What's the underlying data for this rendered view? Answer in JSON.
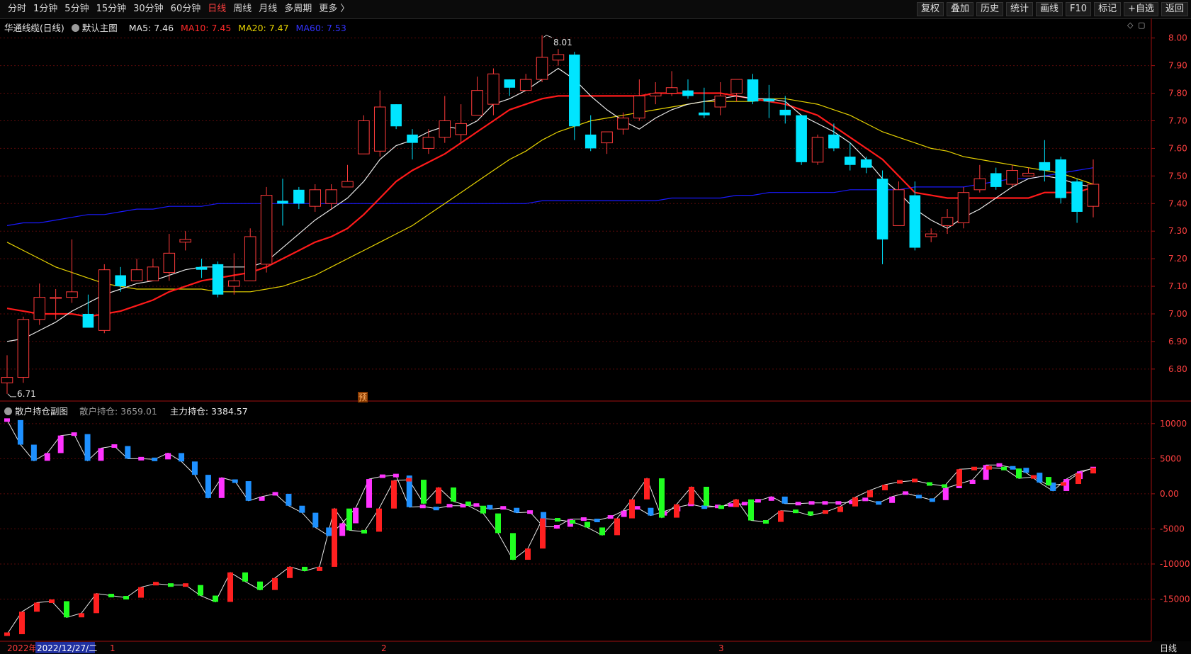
{
  "toolbar": {
    "periods": [
      "分时",
      "1分钟",
      "5分钟",
      "15分钟",
      "30分钟",
      "60分钟",
      "日线",
      "周线",
      "月线",
      "多周期",
      "更多 〉"
    ],
    "active_period": "日线",
    "buttons": [
      "复权",
      "叠加",
      "历史",
      "统计",
      "画线",
      "F10",
      "标记",
      "+自选",
      "返回"
    ]
  },
  "main_legend": {
    "stock_name": "华通线缆(日线)",
    "chart_name": "默认主图",
    "ma5": "MA5: 7.46",
    "ma10": "MA10: 7.45",
    "ma20": "MA20: 7.47",
    "ma60": "MA60: 7.53"
  },
  "sub_legend": {
    "chart_name": "散户持仓副图",
    "retail": "散户持仓: 3659.01",
    "main": "主力持仓: 3384.57"
  },
  "bottom": {
    "cursor_date": "2022/12/27/二",
    "year_prefix": "2022年",
    "month_marks": [
      "1",
      "2",
      "3"
    ],
    "period_label": "日线"
  },
  "annotations": {
    "high": "8.01",
    "low": "6.71",
    "pre_marker": "预"
  },
  "colors": {
    "up": "#ff3b3b",
    "down": "#00e5ff",
    "ma5": "#e8e8e8",
    "ma10": "#ff1a1a",
    "ma20": "#e6d200",
    "ma60": "#1a1aff"
  },
  "chart_data": [
    {
      "type": "candlestick",
      "title": "",
      "ylim": [
        6.72,
        8.03
      ],
      "yticks": [
        "8.00",
        "7.90",
        "7.80",
        "7.70",
        "7.60",
        "7.50",
        "7.40",
        "7.30",
        "7.20",
        "7.10",
        "7.00",
        "6.90",
        "6.80"
      ],
      "candles": [
        [
          6.75,
          6.77,
          6.85,
          6.71
        ],
        [
          6.77,
          6.98,
          6.99,
          6.75
        ],
        [
          6.98,
          7.06,
          7.11,
          6.96
        ],
        [
          7.06,
          7.06,
          7.09,
          6.98
        ],
        [
          7.06,
          7.08,
          7.27,
          7.04
        ],
        [
          7.0,
          6.95,
          7.07,
          6.96
        ],
        [
          6.94,
          7.16,
          7.18,
          6.93
        ],
        [
          7.14,
          7.1,
          7.17,
          7.08
        ],
        [
          7.12,
          7.16,
          7.2,
          7.12
        ],
        [
          7.12,
          7.17,
          7.2,
          7.13
        ],
        [
          7.15,
          7.22,
          7.29,
          7.12
        ],
        [
          7.26,
          7.27,
          7.3,
          7.23
        ],
        [
          7.17,
          7.16,
          7.2,
          7.13
        ],
        [
          7.18,
          7.07,
          7.19,
          7.06
        ],
        [
          7.1,
          7.12,
          7.22,
          7.07
        ],
        [
          7.12,
          7.28,
          7.31,
          7.12
        ],
        [
          7.18,
          7.43,
          7.46,
          7.15
        ],
        [
          7.41,
          7.4,
          7.49,
          7.32
        ],
        [
          7.45,
          7.4,
          7.46,
          7.38
        ],
        [
          7.39,
          7.45,
          7.47,
          7.37
        ],
        [
          7.4,
          7.45,
          7.47,
          7.38
        ],
        [
          7.46,
          7.48,
          7.54,
          7.46
        ],
        [
          7.58,
          7.7,
          7.72,
          7.58
        ],
        [
          7.59,
          7.75,
          7.81,
          7.57
        ],
        [
          7.76,
          7.68,
          7.76,
          7.67
        ],
        [
          7.65,
          7.62,
          7.67,
          7.56
        ],
        [
          7.6,
          7.64,
          7.67,
          7.58
        ],
        [
          7.64,
          7.7,
          7.79,
          7.62
        ],
        [
          7.65,
          7.69,
          7.76,
          7.62
        ],
        [
          7.72,
          7.81,
          7.86,
          7.72
        ],
        [
          7.76,
          7.87,
          7.89,
          7.72
        ],
        [
          7.85,
          7.82,
          7.85,
          7.79
        ],
        [
          7.81,
          7.85,
          7.87,
          7.81
        ],
        [
          7.85,
          7.93,
          8.01,
          7.84
        ],
        [
          7.92,
          7.94,
          7.96,
          7.9
        ],
        [
          7.94,
          7.68,
          7.95,
          7.63
        ],
        [
          7.65,
          7.6,
          7.72,
          7.59
        ],
        [
          7.62,
          7.66,
          7.66,
          7.58
        ],
        [
          7.67,
          7.71,
          7.73,
          7.65
        ],
        [
          7.71,
          7.79,
          7.85,
          7.7
        ],
        [
          7.79,
          7.8,
          7.84,
          7.76
        ],
        [
          7.8,
          7.82,
          7.88,
          7.79
        ],
        [
          7.81,
          7.79,
          7.85,
          7.78
        ],
        [
          7.73,
          7.72,
          7.82,
          7.71
        ],
        [
          7.75,
          7.79,
          7.84,
          7.72
        ],
        [
          7.8,
          7.85,
          7.85,
          7.77
        ],
        [
          7.85,
          7.77,
          7.87,
          7.76
        ],
        [
          7.78,
          7.77,
          7.83,
          7.71
        ],
        [
          7.74,
          7.72,
          7.79,
          7.69
        ],
        [
          7.72,
          7.55,
          7.72,
          7.54
        ],
        [
          7.55,
          7.64,
          7.65,
          7.54
        ],
        [
          7.65,
          7.6,
          7.69,
          7.59
        ],
        [
          7.57,
          7.54,
          7.62,
          7.52
        ],
        [
          7.56,
          7.53,
          7.57,
          7.51
        ],
        [
          7.49,
          7.27,
          7.52,
          7.18
        ],
        [
          7.32,
          7.45,
          7.48,
          7.32
        ],
        [
          7.43,
          7.24,
          7.48,
          7.23
        ],
        [
          7.28,
          7.29,
          7.31,
          7.26
        ],
        [
          7.32,
          7.35,
          7.38,
          7.29
        ],
        [
          7.33,
          7.44,
          7.46,
          7.31
        ],
        [
          7.45,
          7.49,
          7.54,
          7.44
        ],
        [
          7.51,
          7.46,
          7.53,
          7.45
        ],
        [
          7.47,
          7.52,
          7.54,
          7.46
        ],
        [
          7.5,
          7.51,
          7.53,
          7.5
        ],
        [
          7.55,
          7.52,
          7.63,
          7.48
        ],
        [
          7.56,
          7.42,
          7.57,
          7.4
        ],
        [
          7.48,
          7.37,
          7.49,
          7.33
        ],
        [
          7.39,
          7.47,
          7.56,
          7.35
        ]
      ],
      "ma5": [
        6.9,
        6.91,
        6.94,
        6.97,
        7.01,
        7.04,
        7.07,
        7.09,
        7.11,
        7.12,
        7.14,
        7.16,
        7.17,
        7.17,
        7.17,
        7.17,
        7.19,
        7.24,
        7.29,
        7.34,
        7.38,
        7.42,
        7.48,
        7.56,
        7.61,
        7.63,
        7.66,
        7.68,
        7.67,
        7.7,
        7.76,
        7.78,
        7.81,
        7.85,
        7.89,
        7.85,
        7.79,
        7.74,
        7.7,
        7.67,
        7.71,
        7.74,
        7.76,
        7.77,
        7.78,
        7.79,
        7.78,
        7.78,
        7.77,
        7.72,
        7.69,
        7.66,
        7.62,
        7.56,
        7.49,
        7.44,
        7.38,
        7.34,
        7.31,
        7.35,
        7.38,
        7.42,
        7.46,
        7.49,
        7.5,
        7.49,
        7.47,
        7.46
      ],
      "ma10": [
        7.02,
        7.01,
        7.0,
        7.0,
        7.0,
        6.99,
        7.0,
        7.01,
        7.03,
        7.05,
        7.08,
        7.1,
        7.12,
        7.13,
        7.14,
        7.15,
        7.17,
        7.2,
        7.23,
        7.26,
        7.28,
        7.31,
        7.36,
        7.42,
        7.48,
        7.52,
        7.55,
        7.58,
        7.62,
        7.66,
        7.7,
        7.74,
        7.76,
        7.78,
        7.79,
        7.79,
        7.79,
        7.79,
        7.79,
        7.79,
        7.8,
        7.8,
        7.8,
        7.8,
        7.8,
        7.79,
        7.78,
        7.77,
        7.76,
        7.74,
        7.72,
        7.68,
        7.64,
        7.6,
        7.56,
        7.5,
        7.44,
        7.43,
        7.42,
        7.42,
        7.42,
        7.42,
        7.42,
        7.42,
        7.44,
        7.44,
        7.44,
        7.46
      ],
      "ma20": [
        7.26,
        7.23,
        7.2,
        7.17,
        7.15,
        7.13,
        7.11,
        7.1,
        7.09,
        7.09,
        7.09,
        7.09,
        7.09,
        7.08,
        7.08,
        7.08,
        7.09,
        7.1,
        7.12,
        7.14,
        7.17,
        7.2,
        7.23,
        7.26,
        7.29,
        7.32,
        7.36,
        7.4,
        7.44,
        7.48,
        7.52,
        7.56,
        7.59,
        7.63,
        7.66,
        7.68,
        7.7,
        7.71,
        7.72,
        7.73,
        7.74,
        7.75,
        7.76,
        7.77,
        7.77,
        7.77,
        7.77,
        7.78,
        7.78,
        7.77,
        7.76,
        7.74,
        7.72,
        7.69,
        7.66,
        7.64,
        7.62,
        7.6,
        7.59,
        7.57,
        7.56,
        7.55,
        7.54,
        7.53,
        7.52,
        7.51,
        7.49,
        7.47
      ],
      "ma60": [
        7.32,
        7.33,
        7.33,
        7.34,
        7.35,
        7.36,
        7.36,
        7.37,
        7.38,
        7.38,
        7.39,
        7.39,
        7.39,
        7.4,
        7.4,
        7.4,
        7.4,
        7.4,
        7.4,
        7.4,
        7.4,
        7.4,
        7.4,
        7.4,
        7.4,
        7.4,
        7.4,
        7.4,
        7.4,
        7.4,
        7.4,
        7.4,
        7.4,
        7.41,
        7.41,
        7.41,
        7.41,
        7.41,
        7.41,
        7.41,
        7.41,
        7.42,
        7.42,
        7.42,
        7.42,
        7.43,
        7.43,
        7.44,
        7.44,
        7.44,
        7.44,
        7.44,
        7.45,
        7.45,
        7.45,
        7.45,
        7.46,
        7.46,
        7.46,
        7.46,
        7.47,
        7.48,
        7.49,
        7.49,
        7.5,
        7.51,
        7.52,
        7.53
      ]
    },
    {
      "type": "line",
      "title": "",
      "ylim": [
        -20500,
        12000
      ],
      "yticks": [
        "10000",
        "5000",
        "0.00",
        "-5000",
        "-10000",
        "-15000"
      ],
      "series": [
        {
          "name": "散户持仓",
          "values": [
            10500,
            7000,
            4700,
            5800,
            8300,
            8500,
            4700,
            6500,
            6800,
            5000,
            5000,
            4900,
            5800,
            4600,
            2700,
            -600,
            2300,
            1800,
            -1000,
            -400,
            0,
            -1700,
            -2700,
            -4800,
            -6000,
            -4200,
            -2000,
            2100,
            2500,
            2600,
            -1900,
            -1800,
            -2100,
            -1700,
            -1700,
            -1600,
            -2200,
            -2000,
            -2700,
            -2600,
            -4700,
            -4700,
            -3600,
            -3600,
            -3800,
            -3300,
            -2400,
            -2000,
            -3100,
            -2500,
            -1900,
            -1500,
            -1900,
            -1800,
            -1600,
            -1400,
            -1000,
            -400,
            -1400,
            -1400,
            -1300,
            -1300,
            -1300,
            -1200,
            -800,
            -1300,
            -400,
            100,
            -400,
            -900,
            800,
            1400,
            2000,
            4100,
            4100,
            3700,
            3000,
            1600,
            400,
            2100,
            3200,
            3600
          ]
        },
        {
          "name": "主力持仓",
          "values": [
            -20000,
            -16800,
            -15500,
            -15300,
            -17600,
            -17000,
            -14200,
            -14500,
            -14800,
            -13300,
            -12800,
            -13000,
            -13000,
            -14500,
            -15400,
            -11200,
            -12500,
            -13700,
            -12000,
            -10400,
            -11000,
            -10400,
            -2100,
            -5200,
            -5400,
            -2100,
            1900,
            2000,
            -1400,
            900,
            -1100,
            -1700,
            -2800,
            -5600,
            -9400,
            -7800,
            -3500,
            -3700,
            -4000,
            -4800,
            -5900,
            -3500,
            -800,
            2200,
            -3400,
            -1500,
            1000,
            -1700,
            -1900,
            -800,
            -3800,
            -4000,
            -2400,
            -2500,
            -3100,
            -2600,
            -1800,
            -500,
            500,
            1300,
            1700,
            1900,
            1400,
            1100,
            3500,
            3600,
            3700,
            3600,
            2200,
            2400,
            1200,
            1400,
            2900,
            3700
          ]
        }
      ]
    }
  ]
}
